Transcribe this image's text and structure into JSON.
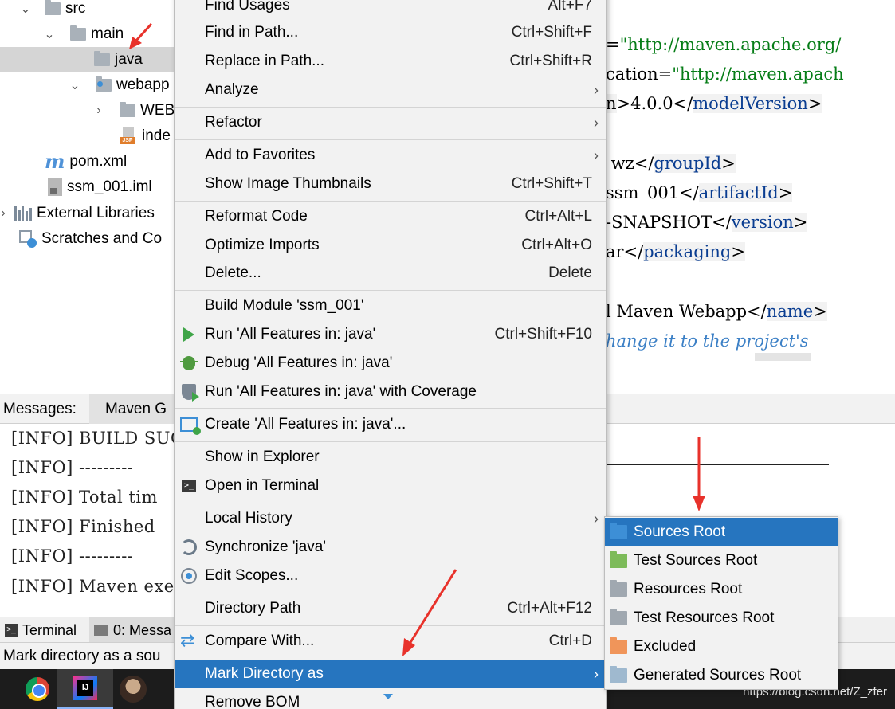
{
  "tree": {
    "items": [
      {
        "label": "src"
      },
      {
        "label": "main"
      },
      {
        "label": "java"
      },
      {
        "label": "webapp"
      },
      {
        "label": "WEB"
      },
      {
        "label": "inde"
      },
      {
        "label": "pom.xml"
      },
      {
        "label": "ssm_001.iml"
      },
      {
        "label": "External Libraries"
      },
      {
        "label": "Scratches and Co"
      }
    ]
  },
  "editor": {
    "lines": [
      {
        "pre": "=",
        "str": "\"http://maven.apache.org/"
      },
      {
        "pre": "cation=",
        "str": "\"http://maven.apach"
      },
      {
        "pre": "n",
        "mid": ">4.0.0</",
        "tag": "modelVersion",
        "post": ">"
      },
      {
        "pre": " wz</",
        "tag": "groupId",
        "post": ">"
      },
      {
        "pre": "ssm_001</",
        "tag": "artifactId",
        "post": ">"
      },
      {
        "pre": "-SNAPSHOT</",
        "tag": "version",
        "post": ">"
      },
      {
        "pre": "ar</",
        "tag": "packaging",
        "post": ">"
      },
      {
        "pre": "l Maven Webapp</",
        "tag": "name",
        "post": ">"
      },
      {
        "comment": "hange it to the project's"
      }
    ]
  },
  "messages": {
    "header_label": "Messages:",
    "tab_maven": "Maven G",
    "lines": [
      "[INFO] BUILD SUC",
      "[INFO] ---------",
      "[INFO] Total tim",
      "[INFO] Finished",
      "[INFO] ---------",
      "[INFO] Maven exe"
    ]
  },
  "bottom_tabs": {
    "terminal": "Terminal",
    "messages": "0: Messa"
  },
  "status": {
    "text": "Mark directory as a sou"
  },
  "watermark": "https://blog.csdn.net/Z_zfer",
  "context_menu": {
    "items": [
      {
        "label": "Find Usages",
        "shortcut": "Alt+F7"
      },
      {
        "label": "Find in Path...",
        "shortcut": "Ctrl+Shift+F"
      },
      {
        "label": "Replace in Path...",
        "shortcut": "Ctrl+Shift+R"
      },
      {
        "label": "Analyze",
        "submenu": "›"
      },
      {
        "label": "Refactor",
        "submenu": "›"
      },
      {
        "label": "Add to Favorites",
        "submenu": "›"
      },
      {
        "label": "Show Image Thumbnails",
        "shortcut": "Ctrl+Shift+T"
      },
      {
        "label": "Reformat Code",
        "shortcut": "Ctrl+Alt+L"
      },
      {
        "label": "Optimize Imports",
        "shortcut": "Ctrl+Alt+O"
      },
      {
        "label": "Delete...",
        "shortcut": "Delete"
      },
      {
        "label": "Build Module 'ssm_001'"
      },
      {
        "label": "Run 'All Features in: java'",
        "shortcut": "Ctrl+Shift+F10"
      },
      {
        "label": "Debug 'All Features in: java'"
      },
      {
        "label": "Run 'All Features in: java' with Coverage"
      },
      {
        "label": "Create 'All Features in: java'..."
      },
      {
        "label": "Show in Explorer"
      },
      {
        "label": "Open in Terminal"
      },
      {
        "label": "Local History",
        "submenu": "›"
      },
      {
        "label": "Synchronize 'java'"
      },
      {
        "label": "Edit Scopes..."
      },
      {
        "label": "Directory Path",
        "shortcut": "Ctrl+Alt+F12"
      },
      {
        "label": "Compare With...",
        "shortcut": "Ctrl+D"
      },
      {
        "label": "Mark Directory as",
        "submenu": "›"
      },
      {
        "label": "Remove BOM"
      }
    ]
  },
  "submenu": {
    "items": [
      {
        "label": "Sources Root",
        "color": "#3d8fd6"
      },
      {
        "label": "Test Sources Root",
        "color": "#7dbb5a"
      },
      {
        "label": "Resources Root",
        "color": "#a0a8b0"
      },
      {
        "label": "Test Resources Root",
        "color": "#a0a8b0"
      },
      {
        "label": "Excluded",
        "color": "#f0955a"
      },
      {
        "label": "Generated Sources Root",
        "color": "#9fb9cf"
      }
    ]
  },
  "colors": {
    "selection": "#2675bf",
    "annotation_arrow": "#e8322b"
  }
}
